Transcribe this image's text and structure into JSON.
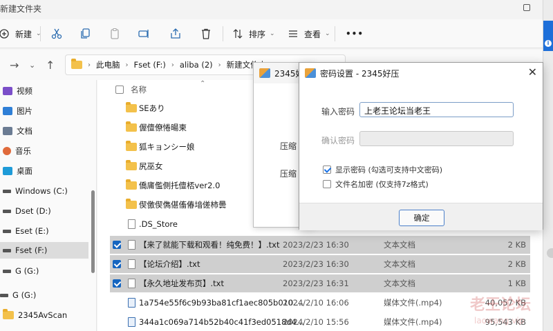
{
  "window": {
    "title": "新建文件夹"
  },
  "toolbar": {
    "new_label": "新建",
    "sort_label": "排序",
    "view_label": "查看",
    "more_label": "•••"
  },
  "address": {
    "crumbs": [
      "此电脑",
      "Fset (F:)",
      "aliba (2)",
      "新建文件夹"
    ]
  },
  "sidebar": {
    "items": [
      {
        "label": "视频",
        "icon": "video-icon"
      },
      {
        "label": "图片",
        "icon": "pictures-icon"
      },
      {
        "label": "文档",
        "icon": "documents-icon"
      },
      {
        "label": "音乐",
        "icon": "music-icon"
      },
      {
        "label": "桌面",
        "icon": "desktop-icon"
      },
      {
        "label": "Windows (C:)",
        "icon": "windows-drive-icon"
      },
      {
        "label": "Dset (D:)",
        "icon": "drive-icon"
      },
      {
        "label": "Eset (E:)",
        "icon": "drive-icon"
      },
      {
        "label": "Fset (F:)",
        "icon": "drive-icon",
        "selected": true
      },
      {
        "label": "G (G:)",
        "icon": "drive-icon"
      },
      {
        "label": "G (G:)",
        "icon": "drive-icon"
      },
      {
        "label": "2345AvScan",
        "icon": "folder-icon"
      }
    ]
  },
  "list": {
    "header_name": "名称",
    "rows": [
      {
        "name": "SEあり",
        "kind": "folder"
      },
      {
        "name": "偓儃僚惓暘柬",
        "kind": "folder"
      },
      {
        "name": "狐キョンシー娘",
        "kind": "folder"
      },
      {
        "name": "尻巫女",
        "kind": "folder"
      },
      {
        "name": "僑庯儖側托儃桮ver2.0",
        "kind": "folder"
      },
      {
        "name": "偰儌偰儁偡傗偆堷傞柿曇",
        "kind": "folder"
      },
      {
        "name": ".DS_Store",
        "kind": "file"
      },
      {
        "name": "【来了就能下载和观看！纯免费！】.txt",
        "date": "2023/2/23 16:30",
        "type": "文本文档",
        "size": "2 KB",
        "kind": "txt",
        "selected": true
      },
      {
        "name": "【论坛介绍】.txt",
        "date": "2023/2/23 16:30",
        "type": "文本文档",
        "size": "2 KB",
        "kind": "txt",
        "selected": true
      },
      {
        "name": "【永久地址发布页】.txt",
        "date": "2023/2/23 16:31",
        "type": "文本文档",
        "size": "1 KB",
        "kind": "txt",
        "selected": true
      },
      {
        "name": "1a754e55f6c9b93ba81cf1aec805b010.m...",
        "date": "2024/2/10 16:06",
        "type": "媒体文件(.mp4)",
        "size": "40,057 KB",
        "kind": "video"
      },
      {
        "name": "344a1c069a714b52b40c41f3ed0518d4...",
        "date": "2024/2/10 15:56",
        "type": "媒体文件(.mp4)",
        "size": "95,543 KB",
        "kind": "video"
      }
    ]
  },
  "back_dialog": {
    "title": "2345好",
    "label1": "压缩",
    "label2": "压缩"
  },
  "dialog": {
    "title": "密码设置 - 2345好压",
    "password_label": "输入密码",
    "password_value": "上老王论坛当老王",
    "confirm_label": "确认密码",
    "confirm_value": "",
    "show_password_label": "显示密码 (勾选可支持中文密码)",
    "show_password_checked": true,
    "encrypt_names_label": "文件名加密 (仅支持7z格式)",
    "encrypt_names_checked": false,
    "ok_label": "确定"
  },
  "watermark": {
    "text": "老王论坛",
    "sub": "laowang.vip"
  },
  "colors": {
    "accent": "#1565c0",
    "folder": "#f3c14b",
    "selection": "#cfcfcf"
  }
}
